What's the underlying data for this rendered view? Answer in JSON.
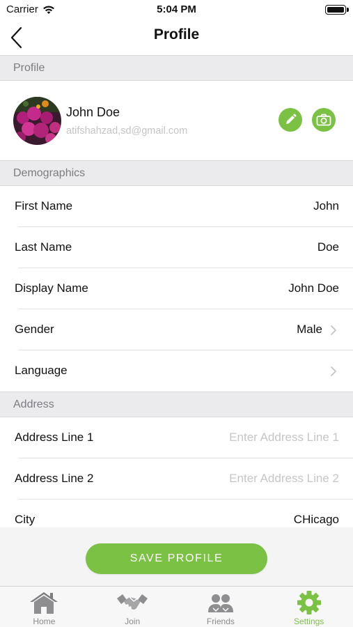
{
  "status_bar": {
    "carrier": "Carrier",
    "time": "5:04 PM"
  },
  "nav": {
    "title": "Profile",
    "back_icon": "chevron-left-icon"
  },
  "sections": {
    "profile": "Profile",
    "demographics": "Demographics",
    "address": "Address"
  },
  "profile": {
    "name": "John Doe",
    "email": "atifshahzad,sd@gmail.com",
    "edit_icon": "pencil-icon",
    "camera_icon": "camera-icon"
  },
  "demographics": {
    "first_name": {
      "label": "First Name",
      "value": "John"
    },
    "last_name": {
      "label": "Last Name",
      "value": "Doe"
    },
    "display_name": {
      "label": "Display Name",
      "value": "John Doe"
    },
    "gender": {
      "label": "Gender",
      "value": "Male"
    },
    "language": {
      "label": "Language",
      "value": ""
    }
  },
  "address": {
    "line1": {
      "label": "Address Line 1",
      "value": "",
      "placeholder": "Enter Address Line 1"
    },
    "line2": {
      "label": "Address Line 2",
      "value": "",
      "placeholder": "Enter Address Line 2"
    },
    "city": {
      "label": "City",
      "value": "CHicago"
    }
  },
  "save_button": "SAVE PROFILE",
  "tabs": [
    {
      "label": "Home",
      "icon": "home-icon",
      "active": false
    },
    {
      "label": "Join",
      "icon": "handshake-icon",
      "active": false
    },
    {
      "label": "Friends",
      "icon": "friends-icon",
      "active": false
    },
    {
      "label": "Settings",
      "icon": "gear-icon",
      "active": true
    }
  ],
  "colors": {
    "accent": "#7bc143",
    "section_bg": "#ebebed",
    "placeholder": "#c6c6c8"
  }
}
